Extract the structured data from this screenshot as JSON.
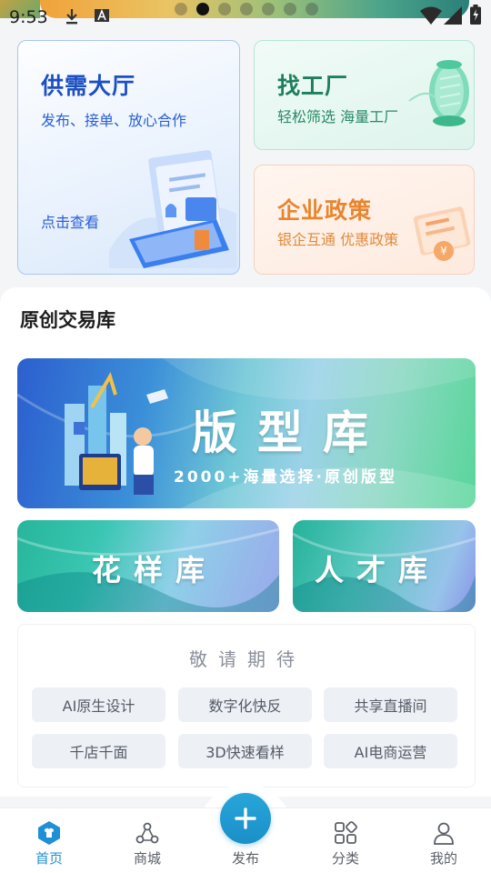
{
  "status_bar": {
    "time": "9:53",
    "icons": [
      "download-icon",
      "font-icon",
      "wifi-icon",
      "signal-icon",
      "battery-icon"
    ]
  },
  "carousel": {
    "page_count": 7,
    "active_index": 1
  },
  "cards": {
    "supply": {
      "title": "供需大厅",
      "subtitle": "发布、接单、放心合作",
      "link": "点击查看"
    },
    "factory": {
      "title": "找工厂",
      "subtitle": "轻松筛选 海量工厂"
    },
    "policy": {
      "title": "企业政策",
      "subtitle": "银企互通 优惠政策"
    }
  },
  "section": {
    "title": "原创交易库",
    "banners": {
      "pattern": {
        "title": "版型库",
        "subtitle": "2000+海量选择·原创版型"
      },
      "flower": {
        "title": "花样库"
      },
      "talent": {
        "title": "人才库"
      }
    },
    "coming_soon": {
      "title": "敬请期待",
      "chips": [
        "AI原生设计",
        "数字化快反",
        "共享直播间",
        "千店千面",
        "3D快速看样",
        "AI电商运营"
      ]
    }
  },
  "bottom_nav": {
    "items": [
      {
        "label": "首页",
        "icon": "home-shirt-icon",
        "active": true
      },
      {
        "label": "商城",
        "icon": "mall-icon",
        "active": false
      },
      {
        "label": "发布",
        "icon": "plus-icon",
        "active": false
      },
      {
        "label": "分类",
        "icon": "category-icon",
        "active": false
      },
      {
        "label": "我的",
        "icon": "profile-icon",
        "active": false
      }
    ]
  },
  "colors": {
    "accent_blue": "#1c4fc4",
    "accent_green": "#1d7f5d",
    "accent_orange": "#e8852e",
    "nav_active": "#1f8fd6"
  }
}
